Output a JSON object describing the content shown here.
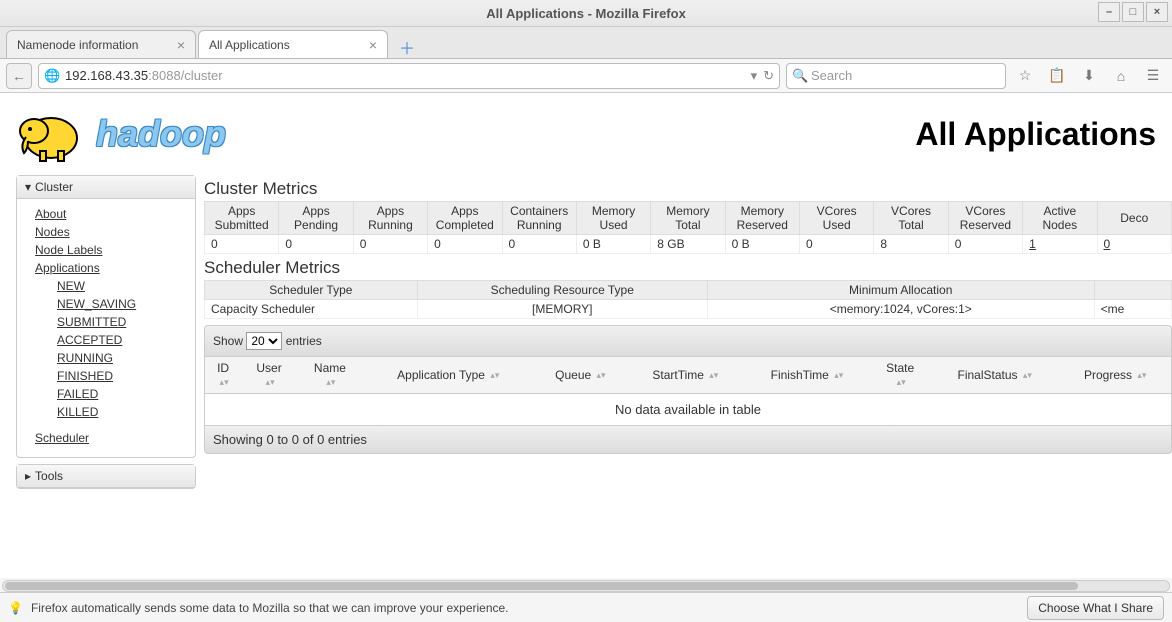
{
  "window": {
    "title": "All Applications - Mozilla Firefox"
  },
  "tabs": [
    {
      "label": "Namenode information",
      "active": false
    },
    {
      "label": "All Applications",
      "active": true
    }
  ],
  "url": {
    "host": "192.168.43.35",
    "port": ":8088",
    "path": "/cluster"
  },
  "search": {
    "placeholder": "Search"
  },
  "hadoop": {
    "logo_text": "hadoop",
    "page_title": "All Applications"
  },
  "sidebar": {
    "cluster_label": "Cluster",
    "tools_label": "Tools",
    "links": {
      "about": "About",
      "nodes": "Nodes",
      "node_labels": "Node Labels",
      "applications": "Applications",
      "scheduler": "Scheduler"
    },
    "app_states": [
      "NEW",
      "NEW_SAVING",
      "SUBMITTED",
      "ACCEPTED",
      "RUNNING",
      "FINISHED",
      "FAILED",
      "KILLED"
    ]
  },
  "cluster_metrics": {
    "title": "Cluster Metrics",
    "headers": [
      "Apps Submitted",
      "Apps Pending",
      "Apps Running",
      "Apps Completed",
      "Containers Running",
      "Memory Used",
      "Memory Total",
      "Memory Reserved",
      "VCores Used",
      "VCores Total",
      "VCores Reserved",
      "Active Nodes",
      "Deco"
    ],
    "row": [
      "0",
      "0",
      "0",
      "0",
      "0",
      "0 B",
      "8 GB",
      "0 B",
      "0",
      "8",
      "0",
      "1",
      "0"
    ]
  },
  "scheduler_metrics": {
    "title": "Scheduler Metrics",
    "headers": [
      "Scheduler Type",
      "Scheduling Resource Type",
      "Minimum Allocation",
      ""
    ],
    "row": [
      "Capacity Scheduler",
      "[MEMORY]",
      "<memory:1024, vCores:1>",
      "<me"
    ]
  },
  "apps_table": {
    "show_label_pre": "Show",
    "show_label_post": "entries",
    "show_value": "20",
    "headers": [
      "ID",
      "User",
      "Name",
      "Application Type",
      "Queue",
      "StartTime",
      "FinishTime",
      "State",
      "FinalStatus",
      "Progress"
    ],
    "empty": "No data available in table",
    "info": "Showing 0 to 0 of 0 entries"
  },
  "infobar": {
    "message": "Firefox automatically sends some data to Mozilla so that we can improve your experience.",
    "button": "Choose What I Share"
  }
}
